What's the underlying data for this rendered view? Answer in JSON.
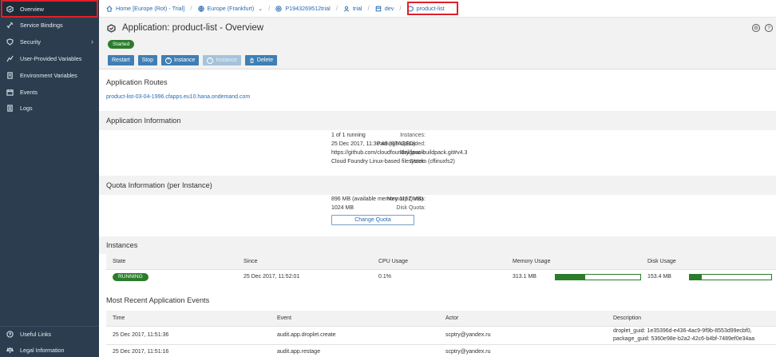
{
  "sidebar": {
    "items": [
      {
        "label": "Overview",
        "icon": "app-icon"
      },
      {
        "label": "Service Bindings",
        "icon": "link-icon"
      },
      {
        "label": "Security",
        "icon": "shield-icon"
      },
      {
        "label": "User-Provided Variables",
        "icon": "variables-icon"
      },
      {
        "label": "Environment Variables",
        "icon": "document-icon"
      },
      {
        "label": "Events",
        "icon": "calendar-icon"
      },
      {
        "label": "Logs",
        "icon": "log-icon"
      }
    ],
    "bottom": [
      {
        "label": "Useful Links",
        "icon": "question-icon"
      },
      {
        "label": "Legal Information",
        "icon": "legal-icon"
      }
    ]
  },
  "breadcrumb": [
    {
      "label": "Home [Europe (Rot) - Trial]",
      "icon": "home-icon"
    },
    {
      "label": "Europe (Frankfurt)",
      "icon": "globe-icon"
    },
    {
      "label": "P1943269512trial",
      "icon": "account-icon"
    },
    {
      "label": "trial",
      "icon": "person-icon"
    },
    {
      "label": "dev",
      "icon": "space-icon"
    },
    {
      "label": "product-list",
      "icon": "app-icon"
    }
  ],
  "header": {
    "title": "Application: product-list - Overview",
    "status": "Started",
    "buttons": {
      "restart": "Restart",
      "stop": "Stop",
      "add_instance": "Instance",
      "remove_instance": "Instance",
      "delete": "Delete"
    }
  },
  "routes": {
    "title": "Application Routes",
    "url": "product-list-03-04-1996.cfapps.eu10.hana.ondemand.com"
  },
  "app_info": {
    "title": "Application Information",
    "rows": [
      {
        "key": "Instances:",
        "value": "1 of 1 running"
      },
      {
        "key": "Package Uploaded:",
        "value": "25 Dec 2017, 11:30:48 (STAGED)"
      },
      {
        "key": "Buildpack:",
        "value": "https://github.com/cloudfoundry/java-buildpack.git#v4.3"
      },
      {
        "key": "Stack:",
        "value": "Cloud Foundry Linux-based filesystem (cflinuxfs2)"
      }
    ]
  },
  "quota": {
    "title": "Quota Information (per Instance)",
    "rows": [
      {
        "key": "Memory Quota:",
        "value": "896 MB (available memory 1152 MB)"
      },
      {
        "key": "Disk Quota:",
        "value": "1024 MB"
      }
    ],
    "change_button": "Change Quota"
  },
  "instances": {
    "title": "Instances",
    "columns": [
      "State",
      "Since",
      "CPU Usage",
      "Memory Usage",
      "Disk Usage"
    ],
    "rows": [
      {
        "state": "RUNNING",
        "since": "25 Dec 2017, 11:52:01",
        "cpu": "0.1%",
        "memory": "313.1 MB",
        "memory_fraction": 0.35,
        "disk": "153.4 MB",
        "disk_fraction": 0.15
      }
    ]
  },
  "events": {
    "title": "Most Recent Application Events",
    "columns": [
      "Time",
      "Event",
      "Actor",
      "Description"
    ],
    "rows": [
      {
        "time": "25 Dec 2017, 11:51:36",
        "event": "audit.app.droplet.create",
        "actor": "scptry@yandex.ru",
        "desc1": "droplet_guid: 1e35396d-e436-4ac9-9f9b-8553d99ecbf0,",
        "desc2": "package_guid: 5360e98e-b2a2-42c6-b4bf-7489ef0e34aa"
      },
      {
        "time": "25 Dec 2017, 11:51:16",
        "event": "audit.app.restage",
        "actor": "scptry@yandex.ru",
        "desc1": "",
        "desc2": ""
      }
    ]
  },
  "colors": {
    "sidebar_bg": "#2b3d4f",
    "accent": "#3f7fb5",
    "status_green": "#2b7d2b",
    "highlight_red": "#e0202a"
  }
}
